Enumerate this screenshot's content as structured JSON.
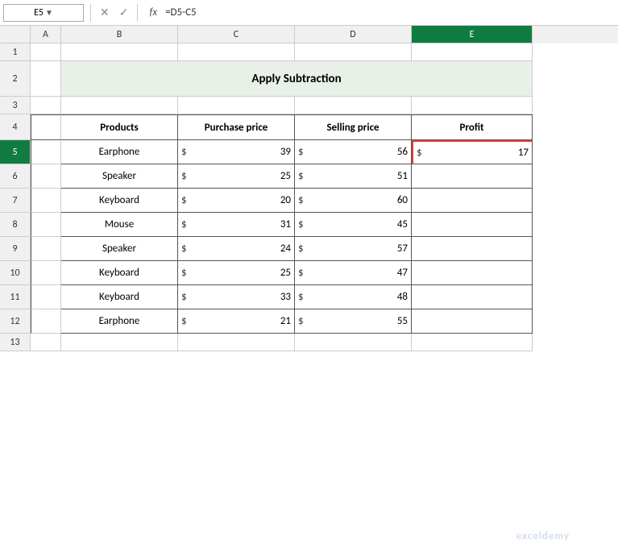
{
  "nameBox": {
    "value": "E5"
  },
  "formulaBar": {
    "formula": "=D5-C5"
  },
  "title": "Apply Subtraction",
  "columns": {
    "A": {
      "label": "A",
      "index": 0
    },
    "B": {
      "label": "B",
      "index": 1
    },
    "C": {
      "label": "C",
      "index": 2
    },
    "D": {
      "label": "D",
      "index": 3
    },
    "E": {
      "label": "E",
      "index": 4,
      "active": true
    }
  },
  "headers": {
    "products": "Products",
    "purchasePrice": "Purchase price",
    "sellingPrice": "Selling price",
    "profit": "Profit"
  },
  "rows": [
    {
      "product": "Earphone",
      "purchasePrice": 39,
      "sellingPrice": 56,
      "profit": 17,
      "profitFormula": true
    },
    {
      "product": "Speaker",
      "purchasePrice": 25,
      "sellingPrice": 51,
      "profit": null
    },
    {
      "product": "Keyboard",
      "purchasePrice": 20,
      "sellingPrice": 60,
      "profit": null
    },
    {
      "product": "Mouse",
      "purchasePrice": 31,
      "sellingPrice": 45,
      "profit": null
    },
    {
      "product": "Speaker",
      "purchasePrice": 24,
      "sellingPrice": 57,
      "profit": null
    },
    {
      "product": "Keyboard",
      "purchasePrice": 25,
      "sellingPrice": 47,
      "profit": null
    },
    {
      "product": "Keyboard",
      "purchasePrice": 33,
      "sellingPrice": 48,
      "profit": null
    },
    {
      "product": "Earphone",
      "purchasePrice": 21,
      "sellingPrice": 55,
      "profit": null
    }
  ],
  "rowNumbers": [
    1,
    2,
    3,
    4,
    5,
    6,
    7,
    8,
    9,
    10,
    11,
    12,
    13
  ],
  "currencySymbol": "$"
}
